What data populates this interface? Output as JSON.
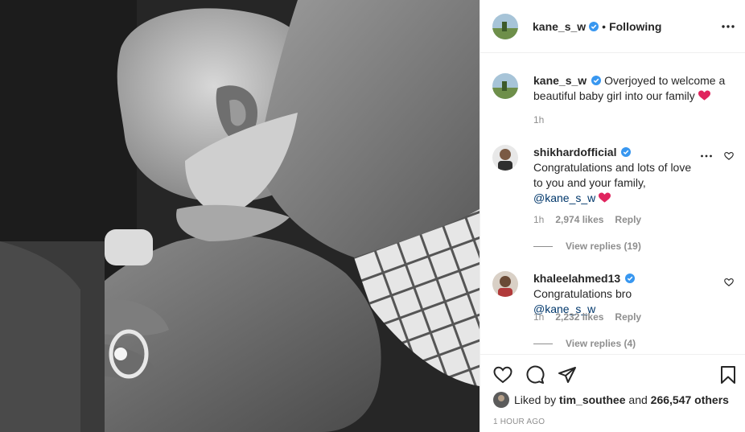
{
  "post": {
    "author": "kane_s_w",
    "follow_separator": "•",
    "follow_status": "Following",
    "caption": "Overjoyed to welcome a beautiful baby girl into our family",
    "caption_time": "1h",
    "posted_ago": "1 HOUR AGO"
  },
  "comments": [
    {
      "user": "shikhardofficial",
      "text": "Congratulations and lots of love to you and your family,",
      "mention": "@kane_s_w",
      "time": "1h",
      "likes": "2,974 likes",
      "reply_label": "Reply",
      "view_replies": "View replies (19)"
    },
    {
      "user": "khaleelahmed13",
      "text": "Congratulations bro",
      "mention": "@kane_s_w",
      "time": "1h",
      "likes": "2,232 likes",
      "reply_label": "Reply",
      "view_replies": "View replies (4)"
    }
  ],
  "likes": {
    "prefix": "Liked by",
    "first_user": "tim_southee",
    "conjunction": "and",
    "others": "266,547 others"
  },
  "icons": {
    "verified": "verified-badge-icon",
    "more": "more-options-icon",
    "like": "heart-outline-icon",
    "comment": "comment-bubble-icon",
    "share": "paper-plane-icon",
    "save": "bookmark-icon"
  },
  "colors": {
    "verified_blue": "#3897f0",
    "heart_red": "#e0245e",
    "mention_blue": "#00376b",
    "muted_gray": "#8e8e8e"
  }
}
